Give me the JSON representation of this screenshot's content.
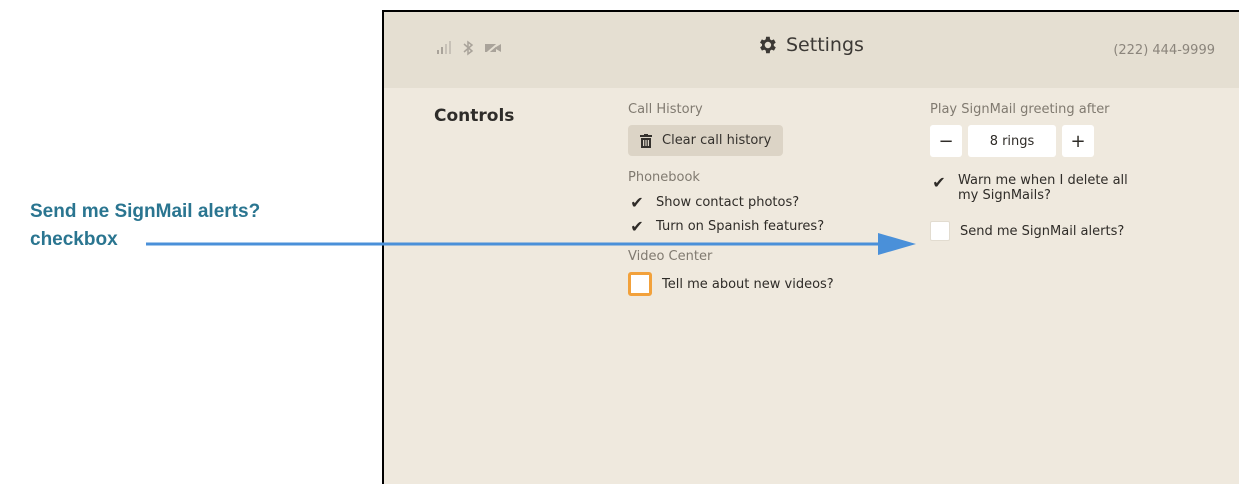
{
  "callout": {
    "line1": "Send me SignMail alerts?",
    "line2": "checkbox"
  },
  "header": {
    "title": "Settings",
    "phone": "(222) 444-9999",
    "status_icons": [
      "signal-icon",
      "bluetooth-icon",
      "video-off-icon"
    ]
  },
  "section": {
    "title": "Controls"
  },
  "call_history": {
    "label": "Call History",
    "clear_button": "Clear call history"
  },
  "phonebook": {
    "label": "Phonebook",
    "options": [
      {
        "label": "Show contact photos?",
        "checked": true
      },
      {
        "label": "Turn on Spanish features?",
        "checked": true
      }
    ]
  },
  "video_center": {
    "label": "Video Center",
    "option": {
      "label": "Tell me about new videos?",
      "checked": false,
      "focused": true
    }
  },
  "signmail": {
    "label": "Play SignMail greeting after",
    "stepper": {
      "minus": "−",
      "value": "8 rings",
      "plus": "+"
    },
    "warn": {
      "label_line1": "Warn me when I delete all",
      "label_line2": "my SignMails?",
      "checked": true
    },
    "alerts": {
      "label": "Send me SignMail alerts?",
      "checked": false
    }
  },
  "colors": {
    "callout": "#2a7590",
    "arrow": "#4a90d9",
    "focus": "#f2a13b",
    "background": "#efe9de"
  }
}
